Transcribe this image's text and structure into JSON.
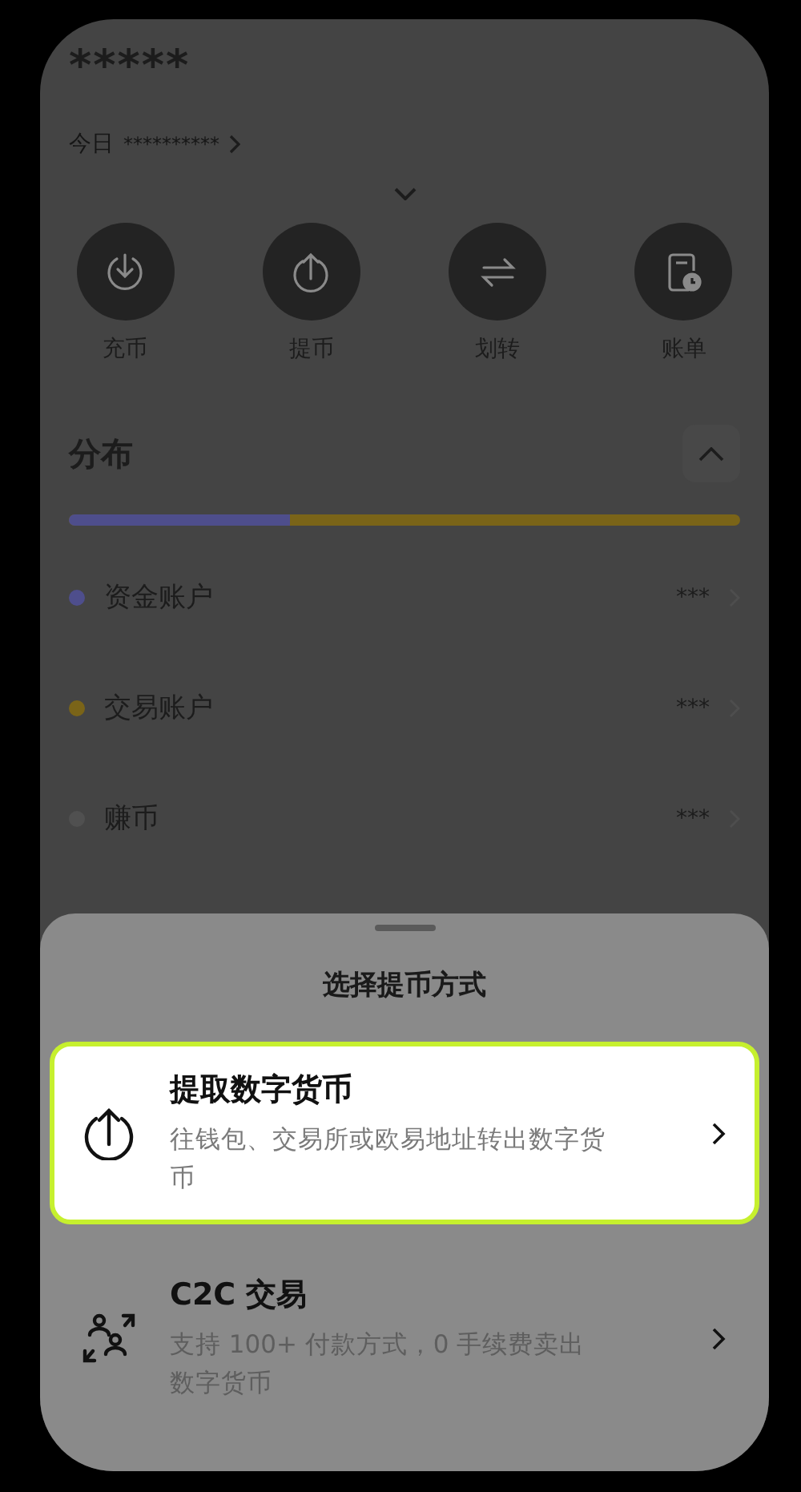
{
  "balance": "*****",
  "today": {
    "label": "今日",
    "value": "**********"
  },
  "actions": [
    {
      "label": "充币",
      "kind": "deposit"
    },
    {
      "label": "提币",
      "kind": "withdraw"
    },
    {
      "label": "划转",
      "kind": "transfer"
    },
    {
      "label": "账单",
      "kind": "bill"
    }
  ],
  "distribution": {
    "title": "分布",
    "expanded": true,
    "level": 0.33,
    "accounts": [
      {
        "name": "资金账户",
        "value": "***",
        "color": "#4e4e8c"
      },
      {
        "name": "交易账户",
        "value": "***",
        "color": "#7a6418"
      },
      {
        "name": "赚币",
        "value": "***",
        "color": "#505050"
      }
    ]
  },
  "sheet": {
    "title": "选择提币方式",
    "options": [
      {
        "kind": "onchain",
        "title": "提取数字货币",
        "description": "往钱包、交易所或欧易地址转出数字货币",
        "selected": true
      },
      {
        "kind": "p2p",
        "title": "C2C 交易",
        "description": "支持 100+ 付款方式，0 手续费卖出数字货币",
        "selected": false
      }
    ]
  }
}
